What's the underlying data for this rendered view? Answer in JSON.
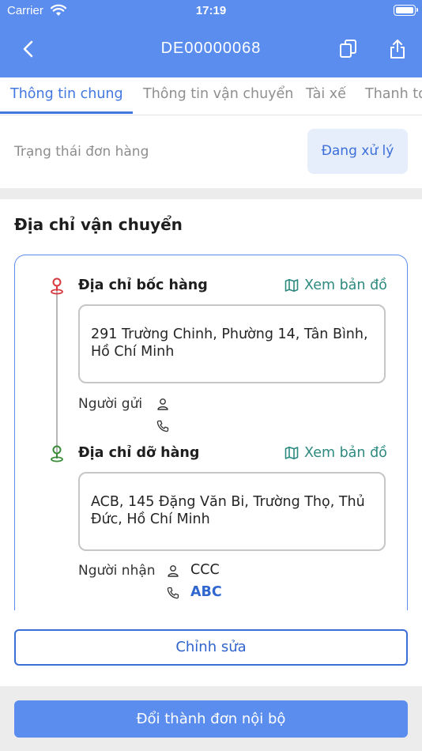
{
  "status_bar": {
    "carrier": "Carrier",
    "time": "17:19"
  },
  "header": {
    "title": "DE00000068"
  },
  "tabs": [
    {
      "label": "Thông tin chung",
      "active": true
    },
    {
      "label": "Thông tin vận chuyển",
      "active": false
    },
    {
      "label": "Tài xế",
      "active": false
    },
    {
      "label": "Thanh toán",
      "active": false
    }
  ],
  "order_status": {
    "label": "Trạng thái đơn hàng",
    "value": "Đang xử lý"
  },
  "shipping": {
    "section_title": "Địa chỉ vận chuyển",
    "pickup": {
      "label": "Địa chỉ bốc hàng",
      "map_link": "Xem bản đồ",
      "address": "291 Trường Chinh, Phường 14, Tân Bình, Hồ Chí Minh",
      "person_label": "Người gửi",
      "name": "",
      "phone": "",
      "pin_color": "#d9363e"
    },
    "dropoff": {
      "label": "Địa chỉ dỡ hàng",
      "map_link": "Xem bản đồ",
      "address": "ACB, 145 Đặng Văn Bi, Trường Thọ, Thủ Đức, Hồ Chí Minh",
      "person_label": "Người nhận",
      "name": "CCC",
      "phone": "ABC",
      "pin_color": "#3a8a3a"
    }
  },
  "buttons": {
    "edit": "Chỉnh sửa",
    "convert": "Đổi thành đơn nội bộ"
  },
  "colors": {
    "primary": "#5b8def",
    "map_link": "#2d8a7e"
  }
}
